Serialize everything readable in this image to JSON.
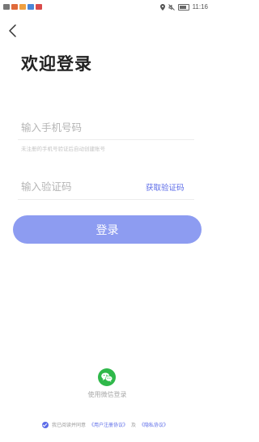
{
  "status_bar": {
    "time": "11:16",
    "left_icons": [
      "sim-icon",
      "notification-icon",
      "notification-icon",
      "message-icon",
      "notification-icon"
    ],
    "right_icons": [
      "location-icon",
      "mute-icon",
      "battery-icon"
    ]
  },
  "page": {
    "title": "欢迎登录"
  },
  "phone": {
    "placeholder": "输入手机号码",
    "hint": "未注册的手机号验证后自动创建账号"
  },
  "code": {
    "placeholder": "输入验证码",
    "get_code_label": "获取验证码"
  },
  "login": {
    "label": "登录"
  },
  "wechat": {
    "label": "使用微信登录"
  },
  "agreement": {
    "prefix": "我已阅读并同意",
    "user_agreement": "《用户注册协议》",
    "and": "及",
    "privacy_policy": "《隐私协议》"
  },
  "colors": {
    "accent": "#5b6be8",
    "login_button": "#8d9cf1",
    "wechat_green": "#2fb84a"
  }
}
